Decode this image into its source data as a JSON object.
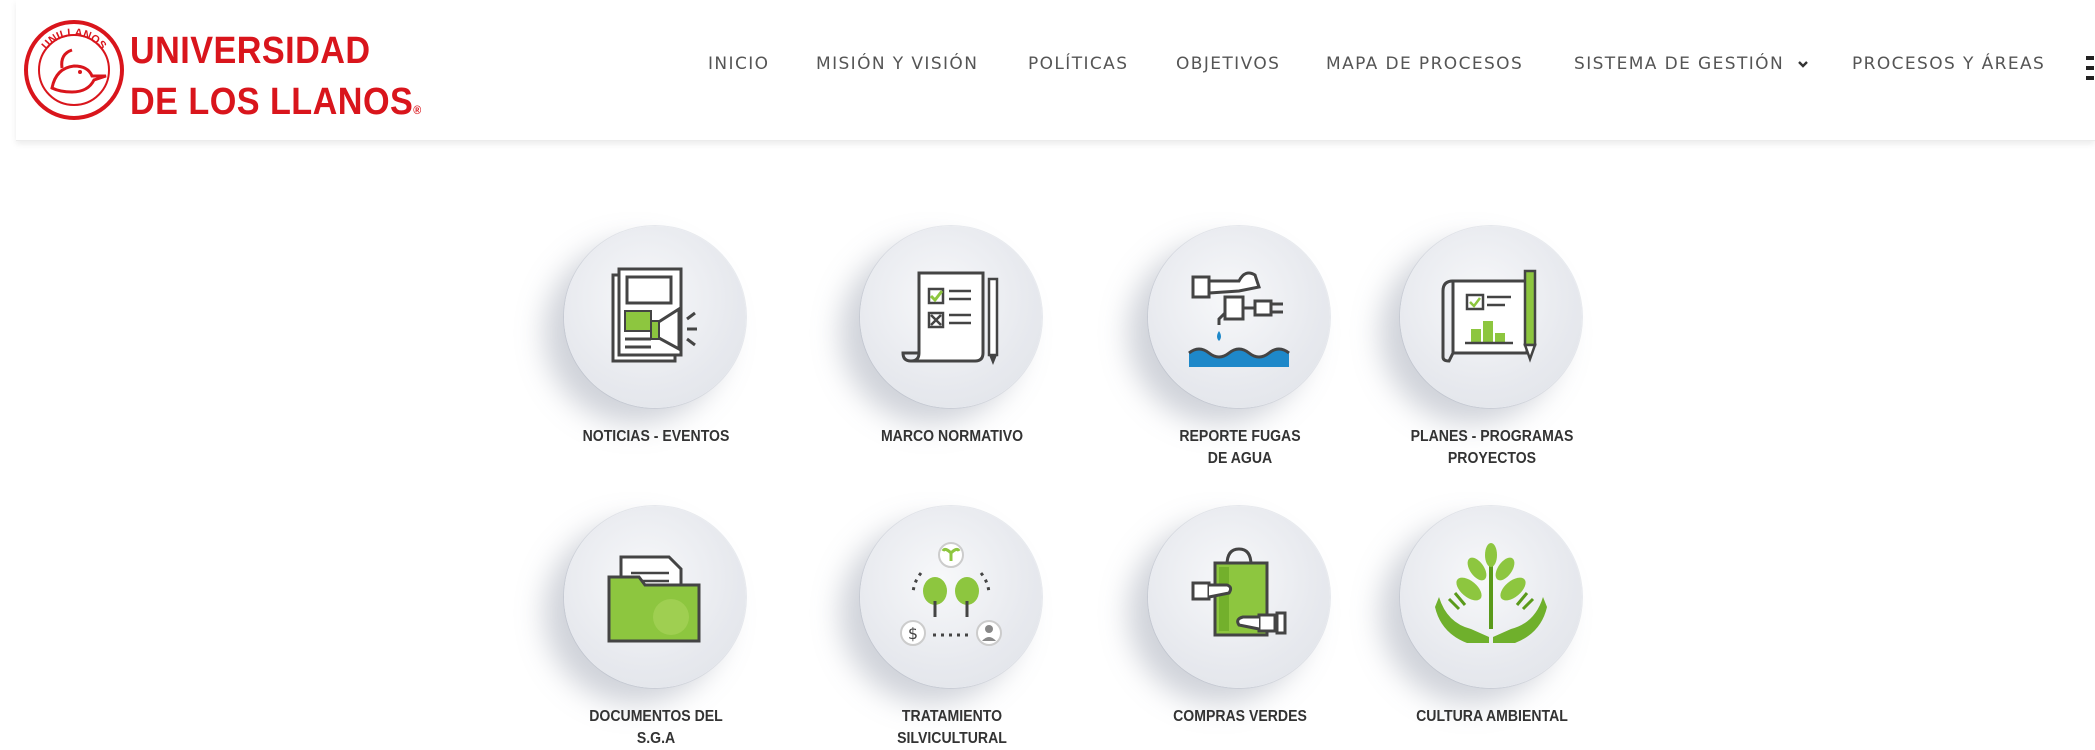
{
  "brand": {
    "name_line1": "UNIVERSIDAD",
    "name_line2": "DE LOS LLANOS",
    "registered": "®",
    "seal_text": "UNILLANOS",
    "color": "#d9151c"
  },
  "nav": {
    "items": [
      {
        "label": "INICIO"
      },
      {
        "label": "MISIÓN Y VISIÓN"
      },
      {
        "label": "POLÍTICAS"
      },
      {
        "label": "OBJETIVOS"
      },
      {
        "label": "MAPA DE PROCESOS"
      },
      {
        "label": "SISTEMA DE GESTIÓN",
        "icon": "chevron-down-icon"
      },
      {
        "label": "PROCESOS Y ÁREAS"
      }
    ],
    "menu_icon": "menu-icon"
  },
  "tiles": [
    {
      "line1": "NOTICIAS - EVENTOS",
      "line2": "",
      "icon": "newspaper-megaphone-icon"
    },
    {
      "line1": "MARCO NORMATIVO",
      "line2": "",
      "icon": "checklist-scroll-icon"
    },
    {
      "line1": "REPORTE FUGAS",
      "line2": "DE AGUA",
      "icon": "water-faucet-icon"
    },
    {
      "line1": "PLANES - PROGRAMAS",
      "line2": "PROYECTOS",
      "icon": "blueprint-pencil-icon"
    },
    {
      "line1": "DOCUMENTOS DEL",
      "line2": "S.G.A",
      "icon": "folder-icon"
    },
    {
      "line1": "TRATAMIENTO",
      "line2": "SILVICULTURAL",
      "icon": "tree-cycle-icon"
    },
    {
      "line1": "COMPRAS VERDES",
      "line2": "",
      "icon": "green-shopping-bag-icon"
    },
    {
      "line1": "CULTURA AMBIENTAL",
      "line2": "",
      "icon": "hands-plant-icon"
    }
  ],
  "colors": {
    "accent_green": "#8dc63f",
    "dark_green": "#5a9a1a",
    "water_blue": "#1e88c9",
    "icon_gray": "#555555"
  }
}
